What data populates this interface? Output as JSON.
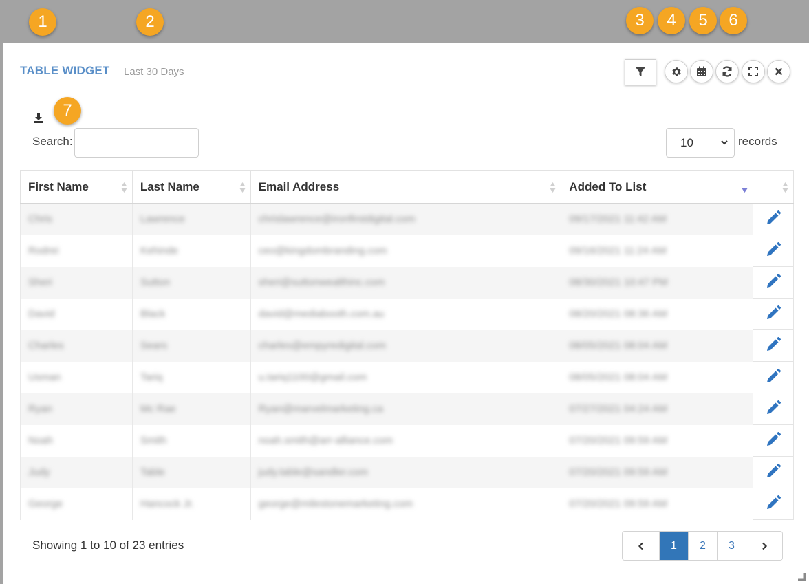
{
  "markers": [
    "1",
    "2",
    "3",
    "4",
    "5",
    "6",
    "7"
  ],
  "widget": {
    "title": "TABLE WIDGET",
    "subtitle": "Last 30 Days"
  },
  "toolbar": {
    "icons": [
      "filter-icon",
      "gear-icon",
      "calendar-icon",
      "refresh-icon",
      "expand-icon",
      "close-icon"
    ]
  },
  "search": {
    "label": "Search:",
    "value": ""
  },
  "records": {
    "selected": "10",
    "label": "records"
  },
  "table": {
    "columns": [
      "First Name",
      "Last Name",
      "Email Address",
      "Added To List",
      ""
    ],
    "rows": [
      {
        "first": "Chris",
        "last": "Lawrence",
        "email": "chrislawrence@ironfirstdigital.com",
        "added": "09/17/2021 11:42 AM"
      },
      {
        "first": "Rodrei",
        "last": "Kehinde",
        "email": "ceo@kingdombranding.com",
        "added": "09/16/2021 11:24 AM"
      },
      {
        "first": "Sheri",
        "last": "Sutton",
        "email": "sheri@suttonwealthinc.com",
        "added": "08/30/2021 10:47 PM"
      },
      {
        "first": "David",
        "last": "Black",
        "email": "david@mediabooth.com.au",
        "added": "08/20/2021 08:36 AM"
      },
      {
        "first": "Charles",
        "last": "Sears",
        "email": "charles@empyredigital.com",
        "added": "08/05/2021 08:04 AM"
      },
      {
        "first": "Usman",
        "last": "Tariq",
        "email": "u.tariq1100@gmail.com",
        "added": "08/05/2021 08:04 AM"
      },
      {
        "first": "Ryan",
        "last": "Mc Rae",
        "email": "Ryan@marvelmarketing.ca",
        "added": "07/27/2021 04:24 AM"
      },
      {
        "first": "Noah",
        "last": "Smith",
        "email": "noah.smith@arr-alliance.com",
        "added": "07/20/2021 09:59 AM"
      },
      {
        "first": "Judy",
        "last": "Table",
        "email": "judy.table@sandler.com",
        "added": "07/20/2021 09:59 AM"
      },
      {
        "first": "George",
        "last": "Hancock Jr.",
        "email": "george@milestonemarketing.com",
        "added": "07/20/2021 09:59 AM"
      }
    ],
    "edit_icon": "pencil-icon"
  },
  "footer": {
    "showing": "Showing 1 to 10 of 23 entries"
  },
  "pagination": {
    "prev": "‹",
    "pages": [
      "1",
      "2",
      "3"
    ],
    "active": "1",
    "next": "›"
  },
  "colors": {
    "marker": "#f5a623",
    "title": "#5a8fc8",
    "accent": "#3276b8"
  }
}
